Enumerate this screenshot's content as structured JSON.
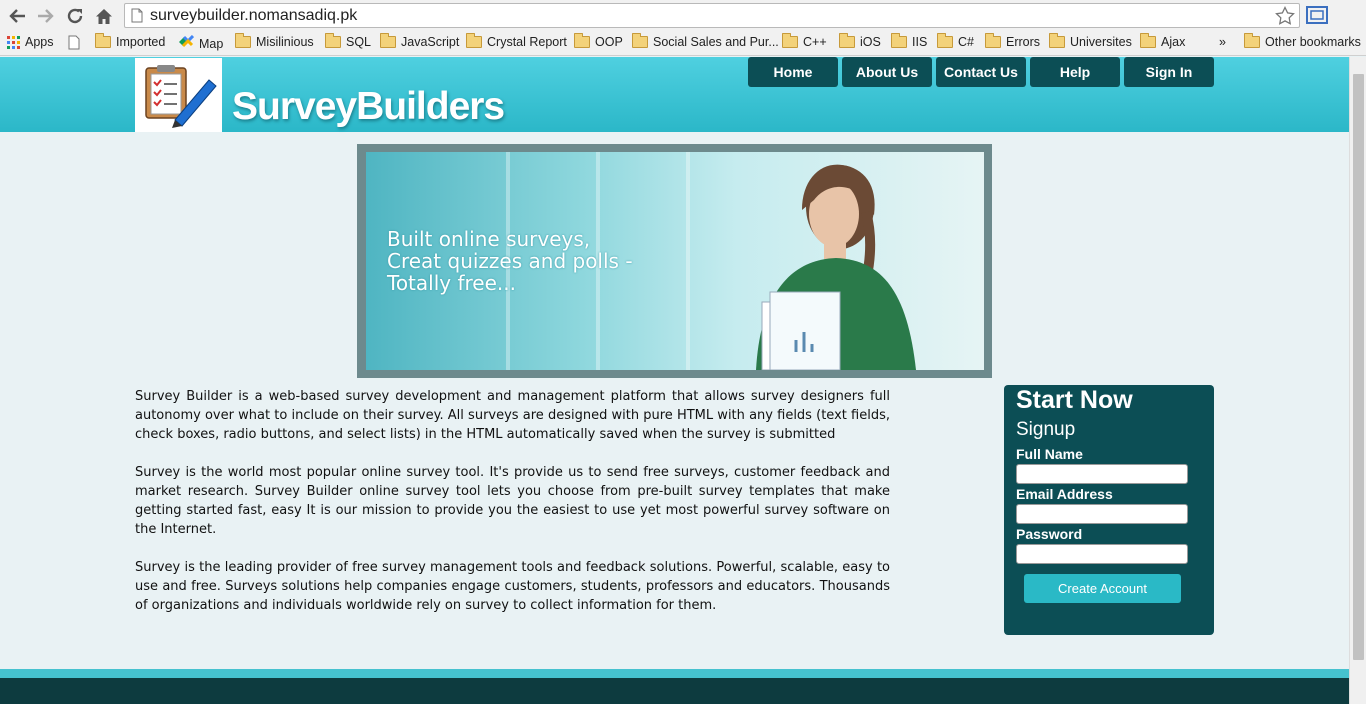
{
  "browser": {
    "url": "surveybuilder.nomansadiq.pk",
    "bookmarks": [
      {
        "label": "Apps",
        "icon": "apps-grid-icon"
      },
      {
        "label": "Imported",
        "icon": "folder-icon"
      },
      {
        "label": "Map",
        "icon": "maps-icon"
      },
      {
        "label": "Misilinious",
        "icon": "folder-icon"
      },
      {
        "label": "SQL",
        "icon": "folder-icon"
      },
      {
        "label": "JavaScript",
        "icon": "folder-icon"
      },
      {
        "label": "Crystal Report",
        "icon": "folder-icon"
      },
      {
        "label": "OOP",
        "icon": "folder-icon"
      },
      {
        "label": "Social Sales and Pur...",
        "icon": "folder-icon"
      },
      {
        "label": "C++",
        "icon": "folder-icon"
      },
      {
        "label": "iOS",
        "icon": "folder-icon"
      },
      {
        "label": "IIS",
        "icon": "folder-icon"
      },
      {
        "label": "C#",
        "icon": "folder-icon"
      },
      {
        "label": "Errors",
        "icon": "folder-icon"
      },
      {
        "label": "Universites",
        "icon": "folder-icon"
      },
      {
        "label": "Ajax",
        "icon": "folder-icon"
      }
    ],
    "overflow": "»",
    "other_bookmarks": "Other bookmarks"
  },
  "site": {
    "logo": "SurveyBuilders",
    "nav": [
      "Home",
      "About Us",
      "Contact Us",
      "Help",
      "Sign In"
    ],
    "banner": "Built online surveys,\nCreat quizzes and polls -\nTotally free...",
    "paragraphs": [
      "Survey Builder is a web-based survey development and management platform that allows survey designers full autonomy over what to include on their survey. All surveys are designed with pure HTML with any fields (text fields, check boxes, radio buttons, and select lists) in the HTML automatically saved when the survey is submitted",
      "Survey is the world most popular online survey tool. It's provide us to send free surveys, customer feedback and market research. Survey Builder online survey tool lets you choose from pre-built survey templates that make getting started fast, easy It is our mission to provide you the easiest to use yet most powerful survey software on the Internet.",
      "Survey is the leading provider of free survey management tools and feedback solutions. Powerful, scalable, easy to use and free. Surveys solutions help companies engage customers, students, professors and educators. Thousands of organizations and individuals worldwide rely on survey to collect information for them."
    ],
    "signup": {
      "title": "Start Now",
      "subtitle": "Signup",
      "full_name_label": "Full Name",
      "full_name_value": "",
      "email_label": "Email Address",
      "email_value": "",
      "password_label": "Password",
      "password_value": "",
      "button": "Create Account"
    }
  },
  "colors": {
    "header": "#2bb7c8",
    "nav_button": "#0c4e55",
    "signup_panel": "#0c4e55",
    "accent_button": "#2ab9c6",
    "footer": "#0d3b3f"
  }
}
